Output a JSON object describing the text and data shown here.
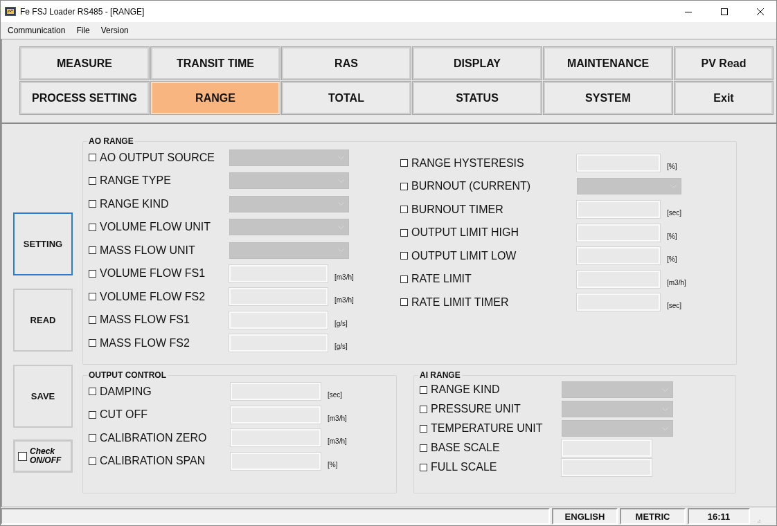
{
  "window": {
    "title": "Fe FSJ Loader RS485 - [RANGE]"
  },
  "menu": [
    "Communication",
    "File",
    "Version"
  ],
  "tabs": [
    {
      "label": "MEASURE",
      "selected": false
    },
    {
      "label": "TRANSIT TIME",
      "selected": false
    },
    {
      "label": "RAS",
      "selected": false
    },
    {
      "label": "DISPLAY",
      "selected": false
    },
    {
      "label": "MAINTENANCE",
      "selected": false
    },
    {
      "label": "PV Read",
      "selected": false
    },
    {
      "label": "PROCESS SETTING",
      "selected": false
    },
    {
      "label": "RANGE",
      "selected": true
    },
    {
      "label": "TOTAL",
      "selected": false
    },
    {
      "label": "STATUS",
      "selected": false
    },
    {
      "label": "SYSTEM",
      "selected": false
    },
    {
      "label": "Exit",
      "selected": false
    }
  ],
  "side_buttons": [
    {
      "label": "SETTING",
      "focused": true
    },
    {
      "label": "READ",
      "focused": false
    },
    {
      "label": "SAVE",
      "focused": false
    }
  ],
  "check_toggle": {
    "label": "Check ON/OFF",
    "checked": false
  },
  "ao_range": {
    "title": "AO RANGE",
    "left": [
      {
        "label": "AO OUTPUT SOURCE",
        "checked": false,
        "kind": "combo"
      },
      {
        "label": "RANGE TYPE",
        "checked": false,
        "kind": "combo"
      },
      {
        "label": "RANGE KIND",
        "checked": false,
        "kind": "combo"
      },
      {
        "label": "VOLUME FLOW UNIT",
        "checked": false,
        "kind": "combo"
      },
      {
        "label": "MASS FLOW UNIT",
        "checked": false,
        "kind": "combo"
      },
      {
        "label": "VOLUME FLOW FS1",
        "checked": false,
        "kind": "text",
        "unit": "[m3/h]"
      },
      {
        "label": "VOLUME FLOW FS2",
        "checked": false,
        "kind": "text",
        "unit": "[m3/h]"
      },
      {
        "label": "MASS FLOW FS1",
        "checked": false,
        "kind": "text",
        "unit": "[g/s]"
      },
      {
        "label": "MASS FLOW FS2",
        "checked": false,
        "kind": "text",
        "unit": "[g/s]"
      }
    ],
    "right": [
      {
        "label": "RANGE HYSTERESIS",
        "checked": false,
        "kind": "text",
        "unit": "[%]"
      },
      {
        "label": "BURNOUT (CURRENT)",
        "checked": false,
        "kind": "combo"
      },
      {
        "label": "BURNOUT TIMER",
        "checked": false,
        "kind": "text",
        "unit": "[sec]"
      },
      {
        "label": "OUTPUT LIMIT HIGH",
        "checked": false,
        "kind": "text",
        "unit": "[%]"
      },
      {
        "label": "OUTPUT LIMIT LOW",
        "checked": false,
        "kind": "text",
        "unit": "[%]"
      },
      {
        "label": "RATE LIMIT",
        "checked": false,
        "kind": "text",
        "unit": "[m3/h]"
      },
      {
        "label": "RATE LIMIT TIMER",
        "checked": false,
        "kind": "text",
        "unit": "[sec]"
      }
    ]
  },
  "output_control": {
    "title": "OUTPUT CONTROL",
    "rows": [
      {
        "label": "DAMPING",
        "checked": false,
        "kind": "text",
        "unit": "[sec]"
      },
      {
        "label": "CUT OFF",
        "checked": false,
        "kind": "text",
        "unit": "[m3/h]"
      },
      {
        "label": "CALIBRATION ZERO",
        "checked": false,
        "kind": "text",
        "unit": "[m3/h]"
      },
      {
        "label": "CALIBRATION SPAN",
        "checked": false,
        "kind": "text",
        "unit": "[%]"
      }
    ]
  },
  "ai_range": {
    "title": "AI RANGE",
    "rows": [
      {
        "label": "RANGE KIND",
        "checked": false,
        "kind": "combo"
      },
      {
        "label": "PRESSURE UNIT",
        "checked": false,
        "kind": "combo"
      },
      {
        "label": "TEMPERATURE UNIT",
        "checked": false,
        "kind": "combo"
      },
      {
        "label": "BASE SCALE",
        "checked": false,
        "kind": "text"
      },
      {
        "label": "FULL SCALE",
        "checked": false,
        "kind": "text"
      }
    ]
  },
  "status_bar": [
    "ENGLISH",
    "METRIC",
    "16:11"
  ]
}
